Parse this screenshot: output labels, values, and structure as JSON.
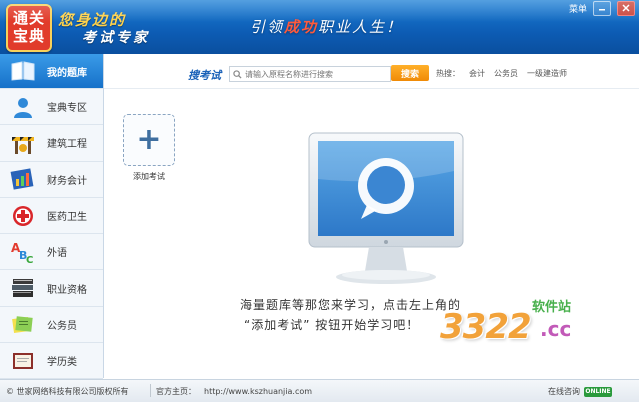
{
  "header": {
    "logo_chars": [
      "通",
      "关",
      "宝",
      "典"
    ],
    "brand_line1": "您身边的",
    "brand_line2": "考试专家",
    "slogan_parts": [
      "引领",
      "成功",
      "职业人生！"
    ],
    "window_menu": "菜单"
  },
  "sidebar": {
    "items": [
      {
        "label": "我的题库",
        "icon": "book-icon",
        "active": true
      },
      {
        "label": "宝典专区",
        "icon": "user-icon"
      },
      {
        "label": "建筑工程",
        "icon": "construction-icon"
      },
      {
        "label": "财务会计",
        "icon": "chart-icon"
      },
      {
        "label": "医药卫生",
        "icon": "medical-cross-icon"
      },
      {
        "label": "外语",
        "icon": "abc-letters-icon"
      },
      {
        "label": "职业资格",
        "icon": "books-stack-icon"
      },
      {
        "label": "公务员",
        "icon": "documents-icon"
      },
      {
        "label": "学历类",
        "icon": "certificate-icon"
      }
    ]
  },
  "search": {
    "title": "搜考试",
    "placeholder": "请输入原程名称进行搜索",
    "button_label": "搜索",
    "hot_label": "热搜：",
    "hot_items": [
      "会计",
      "公务员",
      "一级建造师"
    ]
  },
  "main": {
    "add_exam_label": "添加考试",
    "tip_line1": "海量题库等那您来学习，点击左上角的",
    "tip_line2": "“添加考试” 按钮开始学习吧！"
  },
  "watermark": {
    "number": "3322",
    "suffix": ".cc",
    "site_label": "软件站"
  },
  "footer": {
    "copyright": "© 世家网络科技有限公司版权所有",
    "homepage_label": "官方主页：",
    "homepage_url": "http://www.kszhuanjia.com",
    "consult_label": "在线咨询",
    "online_badge": "ONLINE"
  },
  "colors": {
    "header_blue": "#0d5cb4",
    "sidebar_active": "#1671c9",
    "search_button": "#f08a06",
    "brand_gold": "#ffd24a"
  }
}
